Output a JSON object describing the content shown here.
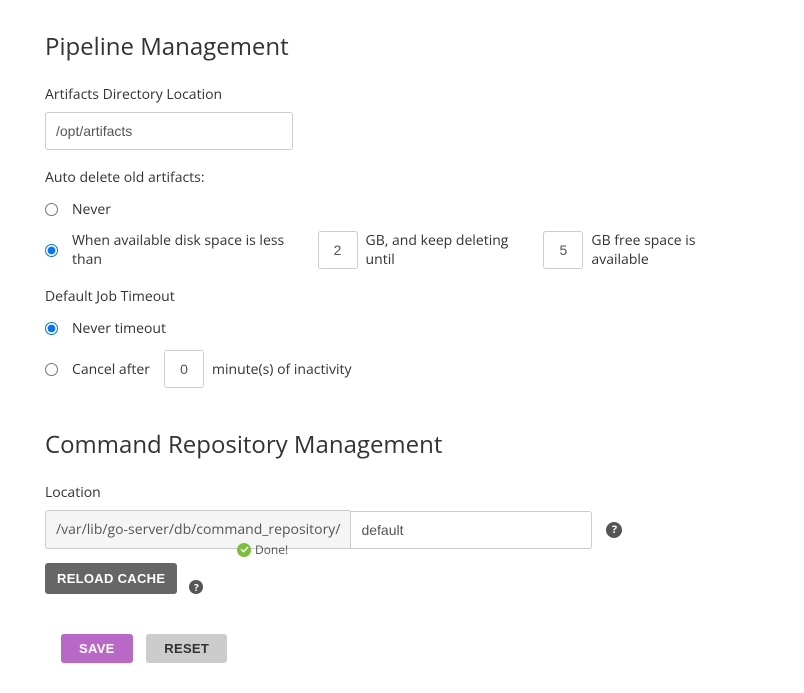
{
  "pipeline": {
    "heading": "Pipeline Management",
    "artifacts_label": "Artifacts Directory Location",
    "artifacts_value": "/opt/artifacts",
    "auto_delete_label": "Auto delete old artifacts:",
    "never_label": "Never",
    "when_prefix": "When available disk space is less than",
    "when_threshold": "2",
    "when_mid": "GB, and keep deleting until",
    "when_target": "5",
    "when_suffix": "GB free space is available",
    "job_timeout_label": "Default Job Timeout",
    "never_timeout_label": "Never timeout",
    "cancel_prefix": "Cancel after",
    "cancel_minutes": "0",
    "cancel_suffix": "minute(s) of inactivity"
  },
  "command_repo": {
    "heading": "Command Repository Management",
    "location_label": "Location",
    "location_prefix": "/var/lib/go-server/db/command_repository/",
    "location_value": "default",
    "reload_label": "RELOAD CACHE",
    "done_text": "Done!"
  },
  "buttons": {
    "save": "SAVE",
    "reset": "RESET"
  }
}
